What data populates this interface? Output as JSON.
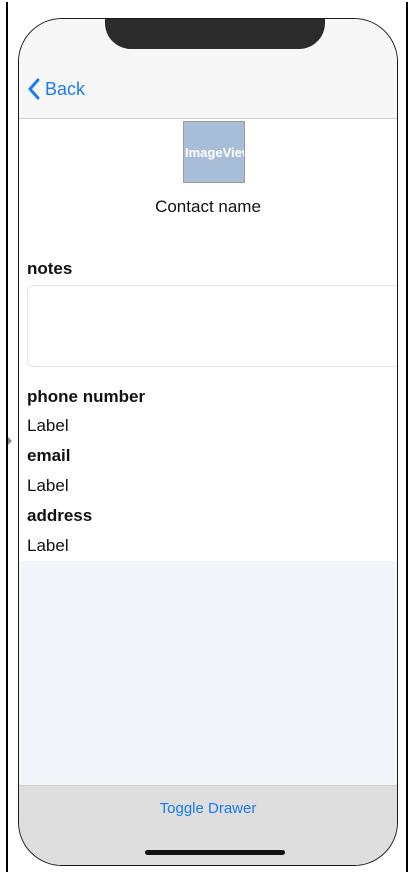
{
  "nav": {
    "back_label": "Back"
  },
  "header": {
    "image_placeholder": "ImageView",
    "contact_name": "Contact name"
  },
  "details": {
    "notes_title": "notes",
    "notes_value": "",
    "phone_title": "phone number",
    "phone_value": "Label",
    "email_title": "email",
    "email_value": "Label",
    "address_title": "address",
    "address_value": "Label"
  },
  "bottom": {
    "toggle_label": "Toggle Drawer"
  },
  "colors": {
    "accent": "#1a7cf2",
    "avatar_bg": "#a8bdd8",
    "drawer_bg": "#f2f5f9",
    "bottom_bar_bg": "#dedede"
  },
  "icons": {
    "back": "chevron-left-icon"
  }
}
